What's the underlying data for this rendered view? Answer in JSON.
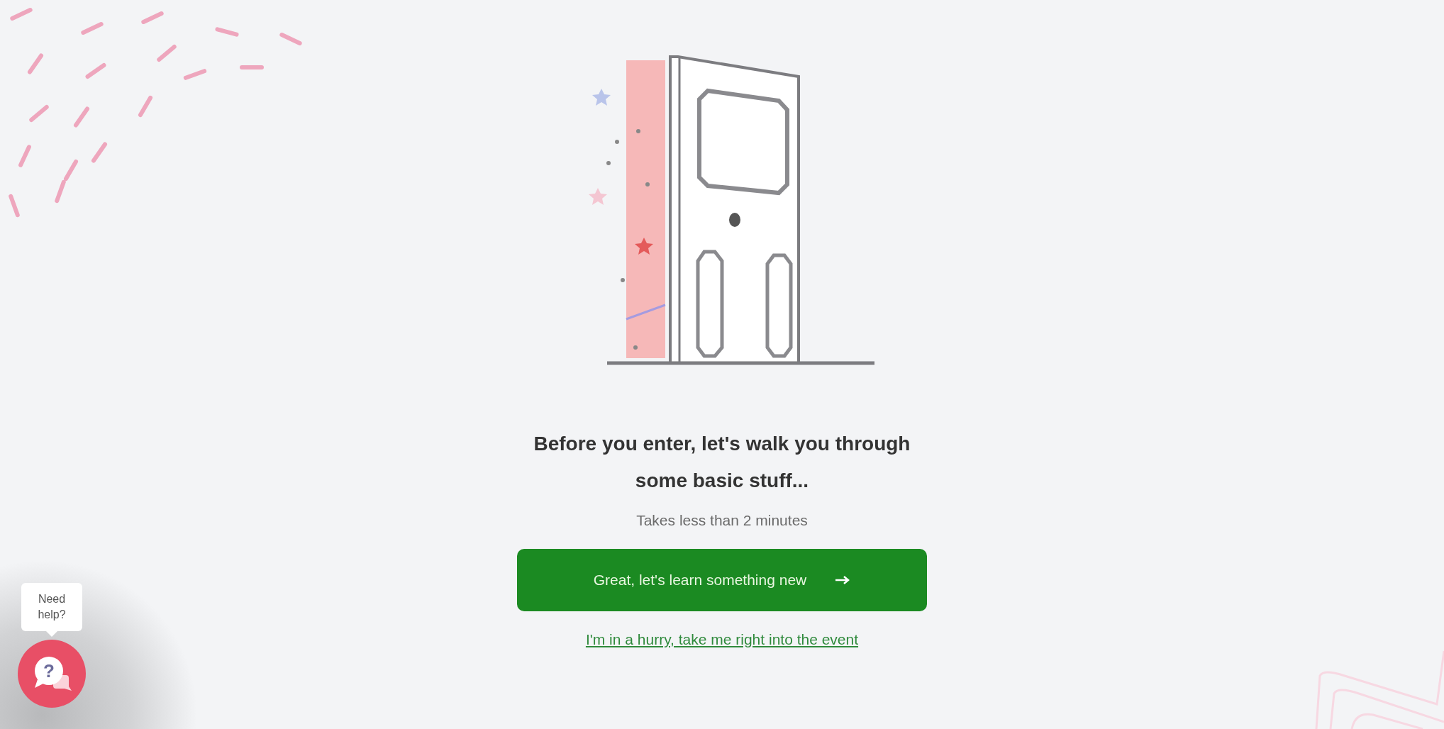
{
  "onboarding": {
    "heading": "Before you enter, let's walk you through some basic stuff...",
    "subtitle": "Takes less than 2 minutes",
    "primary_button": {
      "label": "Great, let's learn something new"
    },
    "skip_link": "I'm in a hurry, take me right into the event"
  },
  "help_widget": {
    "tooltip": "Need help?",
    "icon_glyph": "?"
  }
}
